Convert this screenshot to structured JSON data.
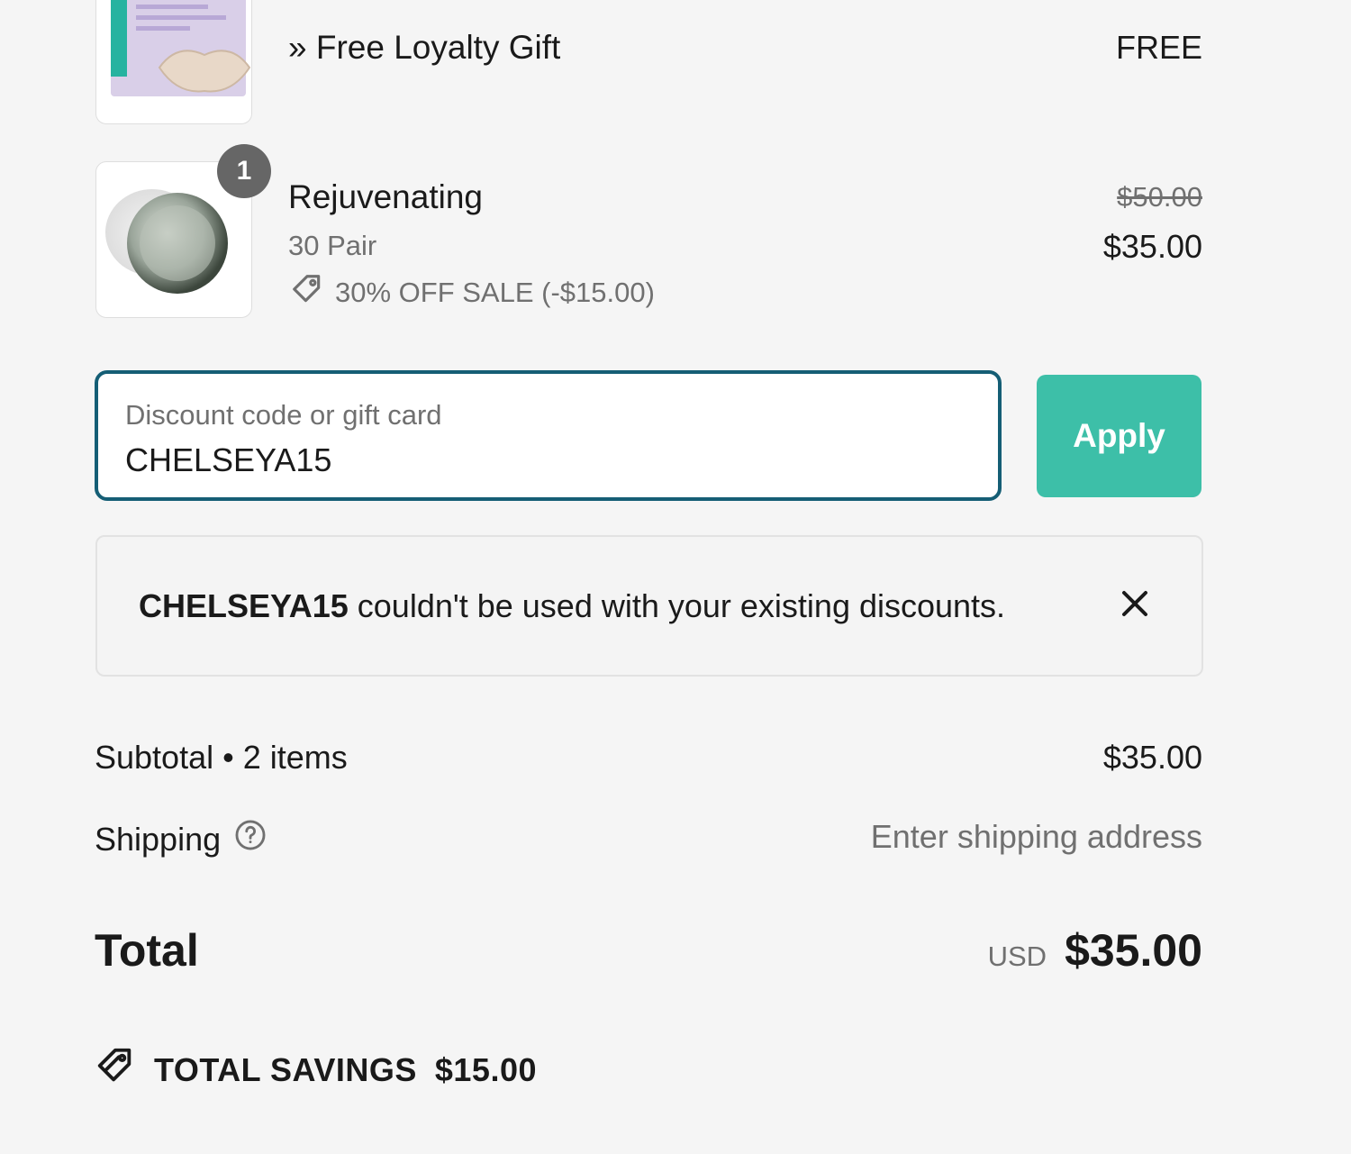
{
  "items": [
    {
      "title": "» Free Loyalty Gift",
      "price": "FREE",
      "image": "lip-mask-box"
    },
    {
      "title": "Rejuvenating",
      "variant": "30 Pair",
      "quantity": "1",
      "discount": "30% OFF SALE (-$15.00)",
      "compare_price": "$50.00",
      "price": "$35.00",
      "image": "eye-patch-jar"
    }
  ],
  "discount_field": {
    "label": "Discount code or gift card",
    "value": "CHELSEYA15",
    "button": "Apply"
  },
  "banner": {
    "code": "CHELSEYA15",
    "message": " couldn't be used with your existing discounts."
  },
  "summary": {
    "subtotal_label": "Subtotal • 2 items",
    "subtotal_value": "$35.00",
    "shipping_label": "Shipping",
    "shipping_value": "Enter shipping address",
    "total_label": "Total",
    "currency": "USD",
    "total_value": "$35.00",
    "savings_label": "TOTAL SAVINGS",
    "savings_value": "$15.00"
  },
  "colors": {
    "accent": "#3dbfa8",
    "focus_border": "#155e75",
    "badge": "#666666"
  }
}
